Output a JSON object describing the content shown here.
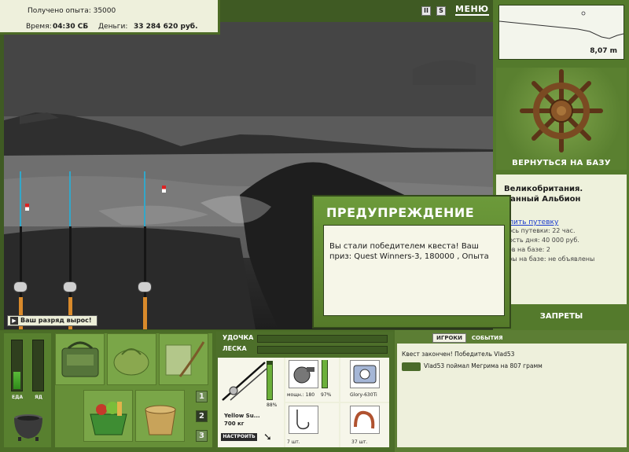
{
  "info": {
    "xp_text": "Получено опыта: 35000",
    "time_label": "Время:",
    "time_value": "04:30 СБ",
    "money_label": "Деньги:",
    "money_value": "33 284 620 руб."
  },
  "toolbar": {
    "pause_label": "II",
    "sound_label": "S",
    "menu_label": "МЕНЮ"
  },
  "depth": {
    "value": "8,07 m"
  },
  "right_panel": {
    "return_label": "ВЕРНУТЬСЯ НА БАЗУ",
    "location_line1": "Великобритания.",
    "location_line2": "манный Альбион",
    "extend_link": "длить путевку",
    "info_lines": [
      "лось путевки: 22 час.",
      "мость дня: 40 000 руб.",
      "ков на базе: 2",
      "иры на базе: не объявлены"
    ],
    "bans_label": "ЗАПРЕТЫ"
  },
  "dialog": {
    "title": "ПРЕДУПРЕЖДЕНИЕ",
    "message": "Вы стали победителем квеста! Ваш приз: Quest Winners-3, 180000 , Опыта"
  },
  "rank_message": "Ваш разряд вырос!",
  "meters": {
    "food_label": "ЕДА",
    "poison_label": "ЯД",
    "food_level": 0.35,
    "poison_level": 0.0
  },
  "inventory": {
    "page_buttons": [
      "1",
      "2",
      "3"
    ],
    "active_page": "2"
  },
  "tackle": {
    "rod_label": "УДОЧКА",
    "line_label": "ЛЕСКА",
    "rod_name": "Yellow Su...",
    "rod_weight": "700 кг",
    "rod_percent": "88%",
    "reel_power_label": "мощн.: 180",
    "reel_percent": "97%",
    "line_name": "Glory-630Ti",
    "hook_count": "7 шт.",
    "bait_count": "37 шт.",
    "setup_label": "НАСТРОИТЬ"
  },
  "chat": {
    "tabs": [
      "ИГРОКИ",
      "СОБЫТИЯ"
    ],
    "active_tab": "ИГРОКИ",
    "messages": [
      "Квест закончен! Победитель Vlad53",
      "Vlad53 поймал Мегрима на 807 грамм"
    ]
  }
}
